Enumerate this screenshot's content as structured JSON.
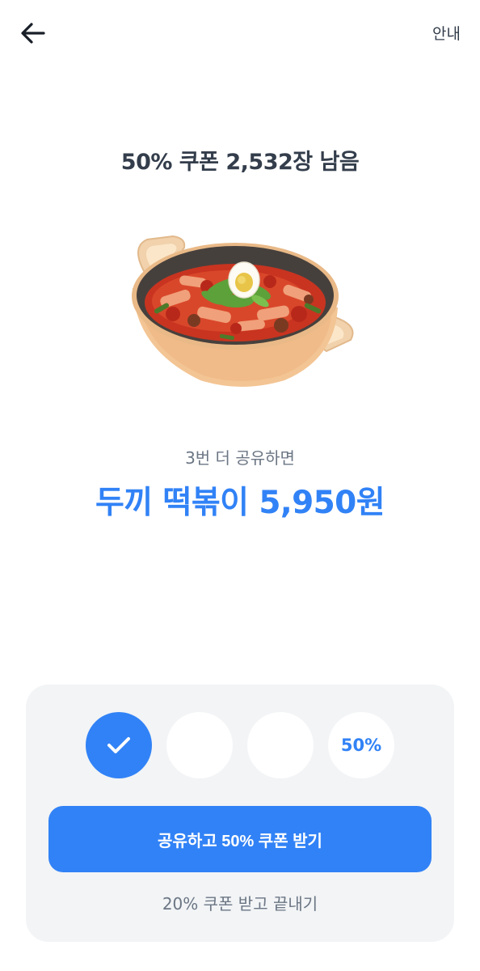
{
  "header": {
    "back_icon": "arrow-left-icon",
    "info_label": "안내"
  },
  "coupon": {
    "headline": "50% 쿠폰 2,532장 남음"
  },
  "product": {
    "image_icon": "tteokbokki-pot-image",
    "share_hint": "3번 더 공유하면",
    "price_text": "두끼 떡볶이 5,950원"
  },
  "progress": {
    "completed_steps": 1,
    "total_steps": 4,
    "check_icon": "check-icon",
    "final_step_label": "50%"
  },
  "actions": {
    "primary_label": "공유하고 50% 쿠폰 받기",
    "secondary_label": "20% 쿠폰 받고 끝내기"
  },
  "colors": {
    "accent": "#3182f6",
    "panel_bg": "#f2f4f6",
    "text_dark": "#333d4b",
    "text_muted": "#6b7684"
  }
}
